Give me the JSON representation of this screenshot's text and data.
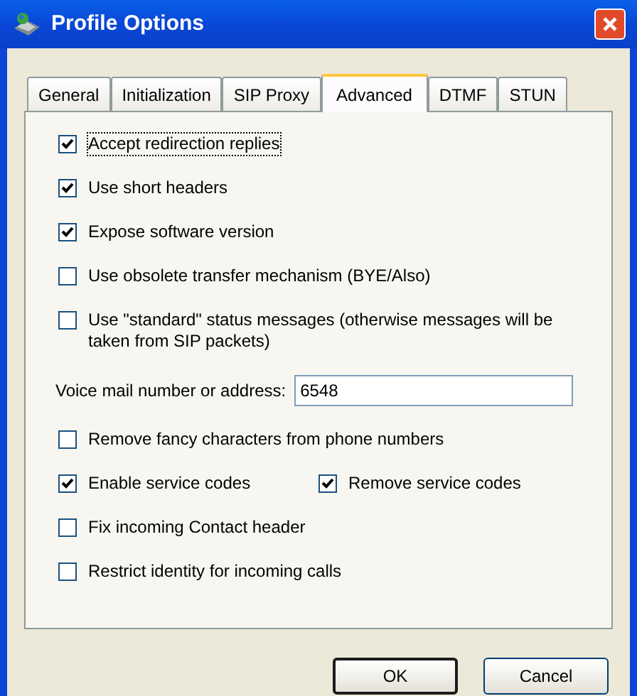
{
  "window": {
    "title": "Profile Options"
  },
  "tabs": [
    {
      "label": "General",
      "selected": false
    },
    {
      "label": "Initialization",
      "selected": false
    },
    {
      "label": "SIP Proxy",
      "selected": false
    },
    {
      "label": "Advanced",
      "selected": true
    },
    {
      "label": "DTMF",
      "selected": false
    },
    {
      "label": "STUN",
      "selected": false
    }
  ],
  "options": [
    {
      "kind": "checkbox",
      "label": "Accept redirection replies",
      "checked": true,
      "focused": true
    },
    {
      "kind": "checkbox",
      "label": "Use short headers",
      "checked": true,
      "focused": false
    },
    {
      "kind": "checkbox",
      "label": "Expose software version",
      "checked": true,
      "focused": false
    },
    {
      "kind": "checkbox",
      "label": "Use obsolete transfer mechanism (BYE/Also)",
      "checked": false,
      "focused": false
    },
    {
      "kind": "checkbox",
      "label": "Use \"standard\" status messages (otherwise messages will be taken from SIP packets)",
      "checked": false,
      "focused": false
    },
    {
      "kind": "field",
      "label": "Voice mail number or address:",
      "value": "6548"
    },
    {
      "kind": "checkbox",
      "label": "Remove fancy characters from phone numbers",
      "checked": false,
      "focused": false
    },
    {
      "kind": "pair",
      "items": [
        {
          "label": "Enable service codes",
          "checked": true,
          "focused": false
        },
        {
          "label": "Remove service codes",
          "checked": true,
          "focused": false
        }
      ]
    },
    {
      "kind": "checkbox",
      "label": "Fix incoming Contact header",
      "checked": false,
      "focused": false
    },
    {
      "kind": "checkbox",
      "label": "Restrict identity for incoming calls",
      "checked": false,
      "focused": false
    }
  ],
  "buttons": [
    {
      "label": "OK",
      "default": true
    },
    {
      "label": "Cancel",
      "default": false
    }
  ]
}
